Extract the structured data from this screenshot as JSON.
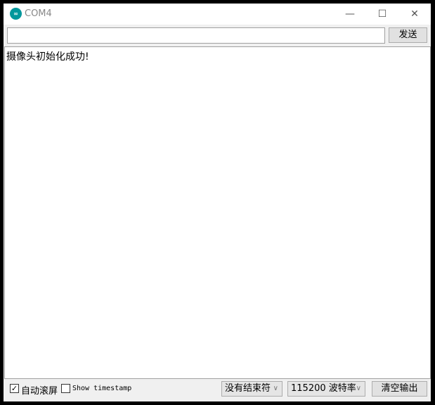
{
  "window": {
    "title": "COM4",
    "minimize": "—",
    "maximize": "☐",
    "close": "✕"
  },
  "send": {
    "value": "",
    "label": "发送"
  },
  "output": {
    "text": "摄像头初始化成功!"
  },
  "bottom": {
    "autoscroll_label": "自动滚屏",
    "autoscroll_checked": true,
    "timestamp_label": "Show timestamp",
    "timestamp_checked": false,
    "line_ending": "没有结束符",
    "baud": "115200 波特率",
    "clear_label": "清空输出"
  },
  "colors": {
    "logo": "#00979c"
  }
}
